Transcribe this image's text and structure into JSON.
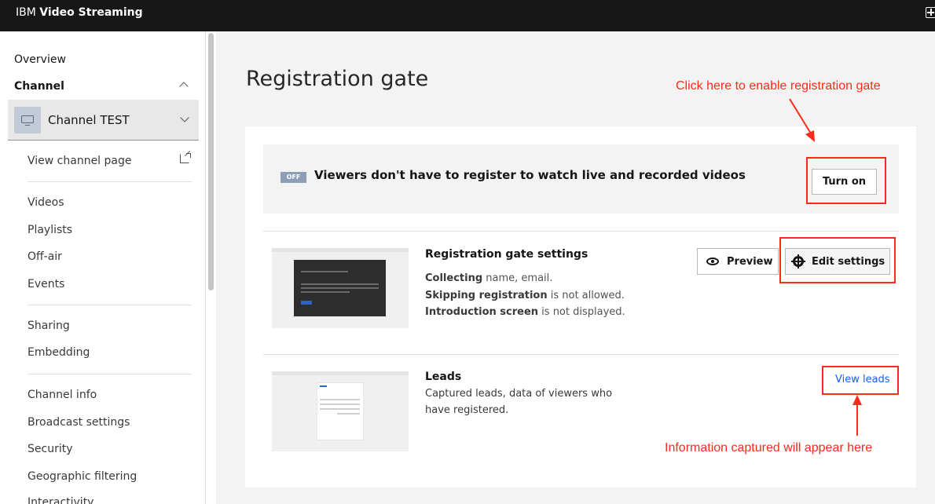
{
  "app": {
    "brand_light": "IBM",
    "brand_bold": "Video Streaming"
  },
  "sidebar": {
    "overview": "Overview",
    "channel_heading": "Channel",
    "channel_select": {
      "value": "Channel TEST",
      "icon": "monitor-icon"
    },
    "group1": [
      {
        "label": "View channel page",
        "icon": "external-link-icon"
      }
    ],
    "group2": [
      "Videos",
      "Playlists",
      "Off-air",
      "Events"
    ],
    "group3": [
      "Sharing",
      "Embedding"
    ],
    "group4": [
      "Channel info",
      "Broadcast settings",
      "Security",
      "Geographic filtering",
      "Interactivity"
    ]
  },
  "main": {
    "title": "Registration gate",
    "status": {
      "badge": "OFF",
      "text": "Viewers don't have to register to watch live and recorded videos",
      "button": "Turn on"
    },
    "settings": {
      "title": "Registration gate settings",
      "lines": [
        {
          "bold": "Collecting",
          "rest": " name, email."
        },
        {
          "bold": "Skipping registration",
          "rest": " is not allowed."
        },
        {
          "bold": "Introduction screen",
          "rest": " is not displayed."
        }
      ],
      "preview_button": "Preview",
      "edit_button": "Edit settings"
    },
    "leads": {
      "title": "Leads",
      "desc_line1": "Captured leads, data of viewers who",
      "desc_line2": "have registered.",
      "link": "View leads"
    }
  },
  "annotations": {
    "top": "Click here to enable registration gate",
    "bottom": "Information captured will appear here",
    "color": "#ff2a1a"
  }
}
